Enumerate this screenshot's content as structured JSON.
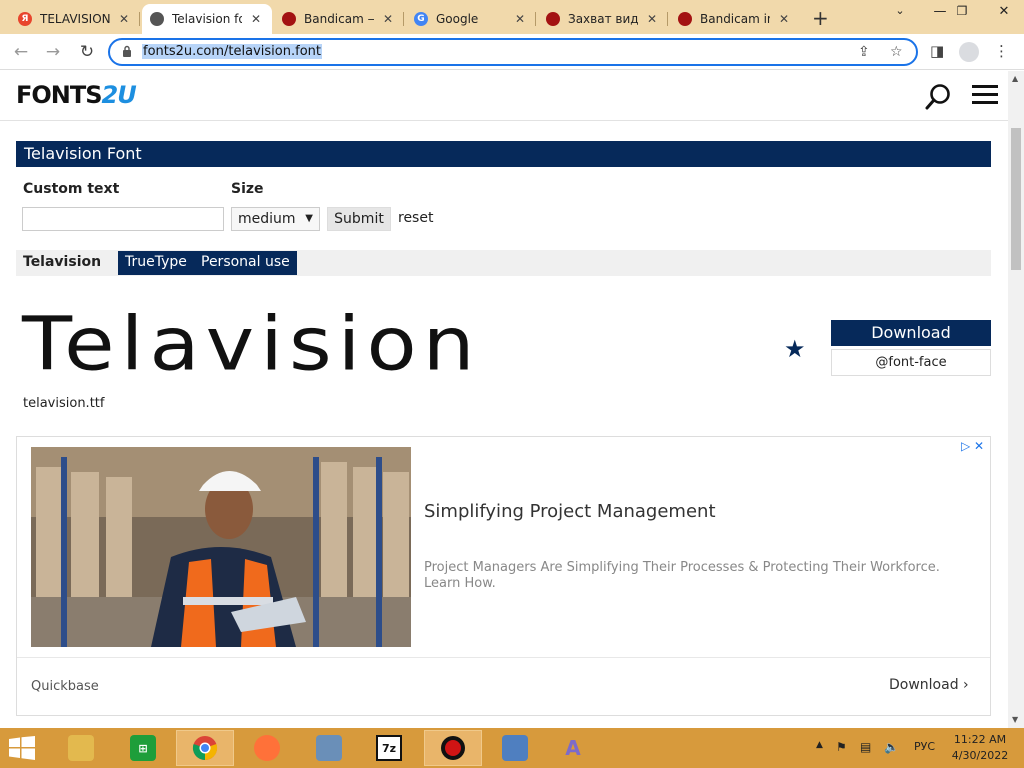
{
  "browser": {
    "tabs": [
      {
        "title": "TELAVISION",
        "favicon_color": "#e8452c",
        "favicon_glyph": "Я",
        "icon": "yandex-icon",
        "active": false
      },
      {
        "title": "Telavision fo",
        "favicon_color": "#555555",
        "favicon_glyph": "",
        "icon": "globe-icon",
        "active": true
      },
      {
        "title": "Bandicam —",
        "favicon_color": "#a31212",
        "favicon_glyph": "",
        "icon": "bandicam-icon",
        "active": false
      },
      {
        "title": "Google",
        "favicon_color": "#4285f4",
        "favicon_glyph": "G",
        "icon": "google-icon",
        "active": false
      },
      {
        "title": "Захват виде",
        "favicon_color": "#a31212",
        "favicon_glyph": "",
        "icon": "bandicam-icon",
        "active": false
      },
      {
        "title": "Bandicam in",
        "favicon_color": "#a31212",
        "favicon_glyph": "",
        "icon": "bandicam-icon",
        "active": false
      }
    ],
    "url": "fonts2u.com/telavision.font"
  },
  "site": {
    "logo_main": "FONTS",
    "logo_accent": "2U"
  },
  "font_page": {
    "title": "Telavision Font",
    "custom_text_label": "Custom text",
    "custom_text_value": "",
    "size_label": "Size",
    "size_value": "medium",
    "submit_label": "Submit",
    "reset_label": "reset",
    "font_name": "Telavision",
    "format_badge": "TrueType",
    "license_badge": "Personal use",
    "preview_text": "Telavision",
    "filename": "telavision.ttf",
    "download_label": "Download",
    "fontface_label": "@font-face"
  },
  "ad": {
    "headline": "Simplifying Project Management",
    "description": "Project Managers Are Simplifying Their Processes & Protecting Their Workforce. Learn How.",
    "advertiser": "Quickbase",
    "cta": "Download"
  },
  "taskbar": {
    "items": [
      {
        "icon": "file-explorer-icon",
        "color": "#e3b94e",
        "active": false
      },
      {
        "icon": "store-icon",
        "color": "#1e9e3a",
        "active": false
      },
      {
        "icon": "chrome-icon",
        "color": "#db4437",
        "active": true
      },
      {
        "icon": "firefox-icon",
        "color": "#ff7139",
        "active": false
      },
      {
        "icon": "network-tool-icon",
        "color": "#6a8fb8",
        "active": false
      },
      {
        "icon": "7zip-icon",
        "color": "#111111",
        "glyph": "7z",
        "active": false
      },
      {
        "icon": "bandicam-icon",
        "color": "#b01212",
        "active": true
      },
      {
        "icon": "control-panel-icon",
        "color": "#4f7fc0",
        "active": false
      },
      {
        "icon": "app-a-icon",
        "color": "#7d6bc9",
        "glyph": "A",
        "active": false
      }
    ],
    "language": "РУС",
    "time": "11:22 AM",
    "date": "4/30/2022"
  }
}
